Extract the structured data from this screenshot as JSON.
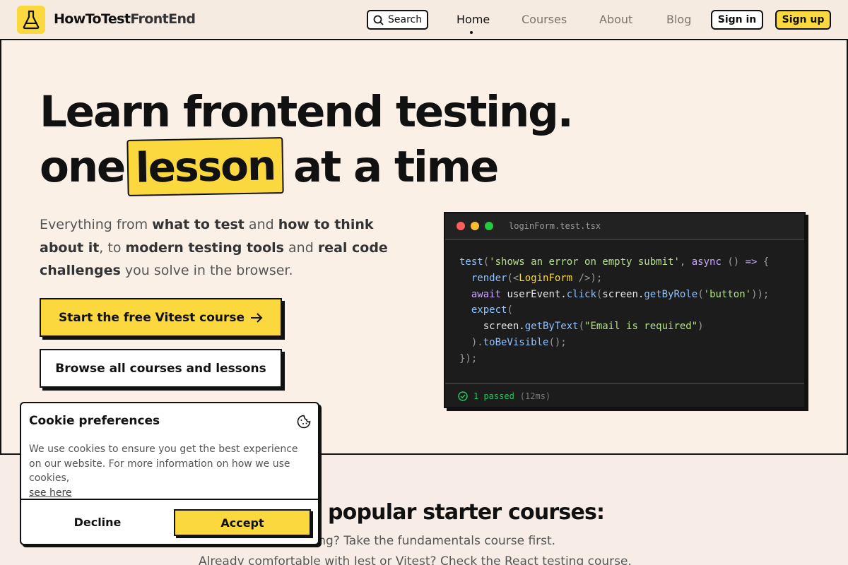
{
  "nav": {
    "logo_icon": "flask-icon",
    "logo_main": "HowToTest",
    "logo_accent": "FrontEnd",
    "search_label": "Search",
    "links": [
      "Home",
      "Courses",
      "About",
      "Blog"
    ],
    "active_link": "Home",
    "sign_in": "Sign in",
    "sign_up": "Sign up"
  },
  "hero": {
    "headline_line1": "Learn frontend testing.",
    "headline_line2_start": "one",
    "headline_highlight": "lesson",
    "headline_line2_end": "at a time",
    "sub_1": "Everything from ",
    "sub_b1": "what to test",
    "sub_2": " and ",
    "sub_b2": "how to think about it",
    "sub_3": ", to ",
    "sub_b3": "modern testing tools",
    "sub_4": " and ",
    "sub_b4": "real code challenges",
    "sub_5": " you solve in the browser.",
    "cta_primary": "Start the free Vitest course",
    "cta_secondary": "Browse all courses and lessons"
  },
  "code": {
    "file_name": "loginForm.test.tsx",
    "status": "1 passed",
    "duration": "(12ms)"
  },
  "starter": {
    "heading": "popular starter courses:",
    "line1": "sting? Take the fundamentals course first.",
    "line2": "Already comfortable with Jest or Vitest? Check the React testing course."
  },
  "cookie": {
    "title": "Cookie preferences",
    "text": "We use cookies to ensure you get the best experience on our website. For more information on how we use cookies,",
    "link": "see here",
    "decline": "Decline",
    "accept": "Accept"
  },
  "colors": {
    "accent": "#fbd83d",
    "background": "#fbf0e6",
    "ink": "#111111"
  }
}
